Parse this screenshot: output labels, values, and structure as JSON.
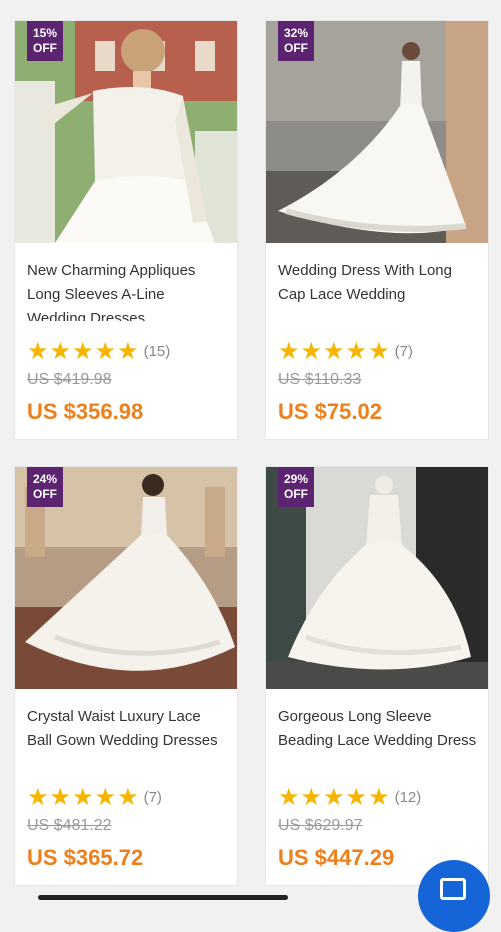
{
  "products": [
    {
      "discount": "15%",
      "discount_suffix": "OFF",
      "title": "New Charming Appliques Long Sleeves A-Line Wedding Dresses",
      "rating_count": "(15)",
      "old_price": "US $419.98",
      "price": "US $356.98"
    },
    {
      "discount": "32%",
      "discount_suffix": "OFF",
      "title": "Wedding Dress With Long Cap Lace Wedding",
      "rating_count": "(7)",
      "old_price": "US $110.33",
      "price": "US $75.02"
    },
    {
      "discount": "24%",
      "discount_suffix": "OFF",
      "title": "Crystal Waist Luxury Lace Ball Gown Wedding Dresses",
      "rating_count": "(7)",
      "old_price": "US $481.22",
      "price": "US $365.72"
    },
    {
      "discount": "29%",
      "discount_suffix": "OFF",
      "title": "Gorgeous Long Sleeve Beading Lace Wedding Dress",
      "rating_count": "(12)",
      "old_price": "US $629.97",
      "price": "US $447.29"
    }
  ],
  "rating_stars": 5,
  "icons": {
    "star": "star-icon",
    "chat": "chat-bubble-icon"
  },
  "colors": {
    "badge": "#5b2370",
    "price": "#ee7f1b",
    "star": "#f7b500",
    "fab": "#1565d8"
  }
}
